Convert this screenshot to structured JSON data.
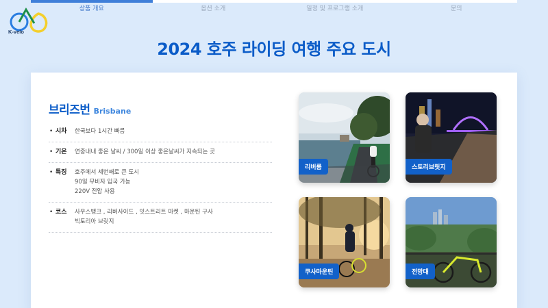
{
  "brand": {
    "logo_text": "K-velo"
  },
  "nav": {
    "items": [
      {
        "label": "상품 개요",
        "active": true
      },
      {
        "label": "옵션 소개",
        "active": false
      },
      {
        "label": "일정 및 프로그램 소개",
        "active": false
      },
      {
        "label": "문의",
        "active": false
      }
    ]
  },
  "page": {
    "title": "2024 호주 라이딩 여행 주요 도시"
  },
  "city": {
    "name_ko": "브리즈번",
    "name_en": "Brisbane",
    "info": [
      {
        "label": "시차",
        "lines": [
          "한국보다 1시간 빠름"
        ]
      },
      {
        "label": "기온",
        "lines": [
          "연중내내 좋은 날씨 / 300일 이상 좋은날씨가 지속되는 곳"
        ]
      },
      {
        "label": "특징",
        "lines": [
          "호주에서 세번째로 큰 도시",
          "90일 무비자 입국 가능",
          "220V 전압 사용"
        ]
      },
      {
        "label": "코스",
        "lines": [
          "사우스뱅크 , 리버사이드 , 잇스트리트 마켓 , 마운틴 구사",
          "빅토리아 브릿지"
        ]
      }
    ]
  },
  "photos": [
    {
      "label": "리버룸",
      "icon": "riverside-cyclist-photo"
    },
    {
      "label": "스토리브릿지",
      "icon": "story-bridge-night-photo"
    },
    {
      "label": "쿠사마운틴",
      "icon": "mount-coot-tha-cyclist-photo"
    },
    {
      "label": "전망대",
      "icon": "lookout-city-view-photo"
    }
  ],
  "colors": {
    "accent": "#0b5cc8",
    "label_bg": "#1261c9",
    "background": "#dbeafb"
  }
}
